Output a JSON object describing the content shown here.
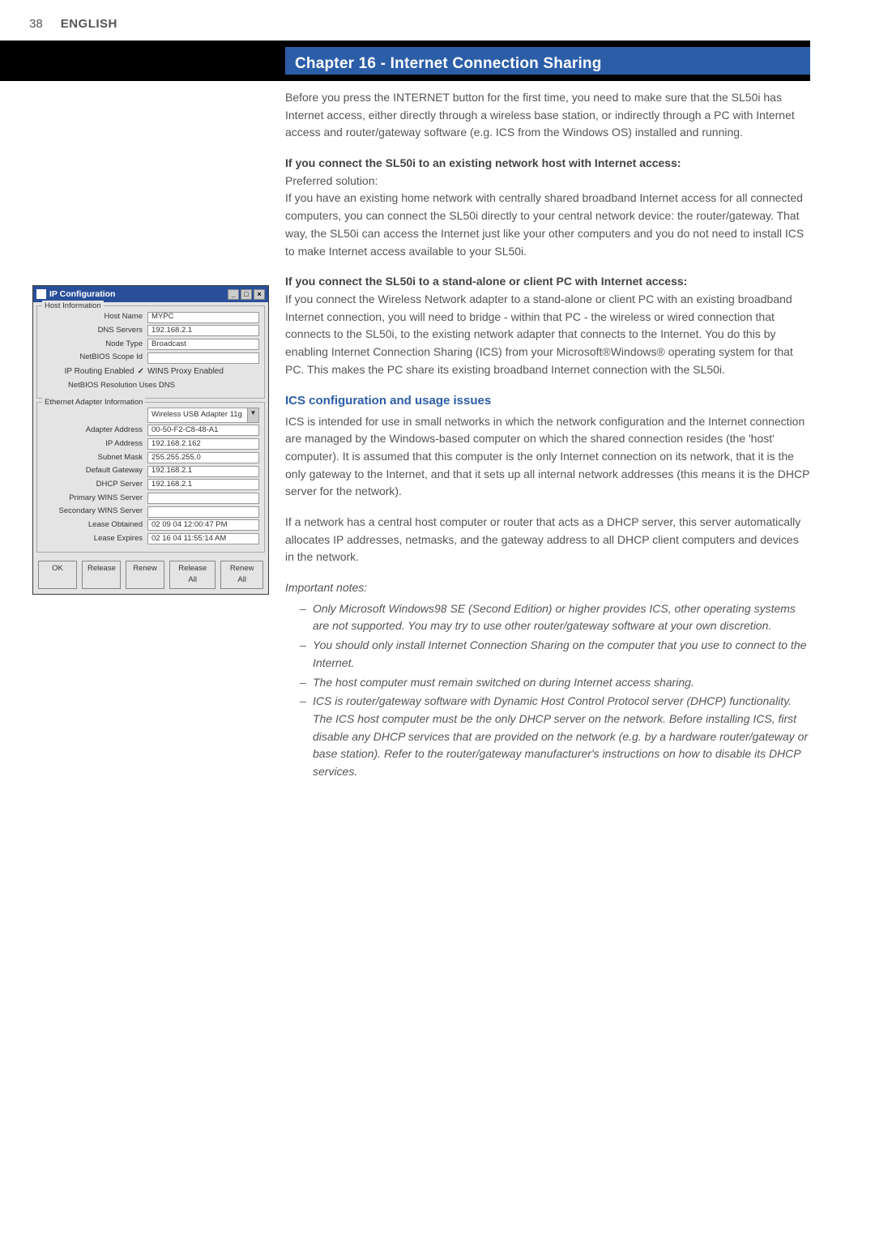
{
  "header": {
    "page_number": "38",
    "language": "ENGLISH"
  },
  "banner": {
    "title": "Chapter 16 - Internet Connection Sharing"
  },
  "body": {
    "intro": "Before you press the INTERNET button for the first time, you need to make sure that the SL50i has Internet access, either directly through a wireless base station, or indirectly through a PC with Internet access and router/gateway software (e.g. ICS from the Windows OS) installed and running.",
    "scen1_head": "If you connect the SL50i to an existing network host with Internet access:",
    "scen1_sub": "Preferred solution:",
    "scen1_body": "If you have an existing home network with centrally shared broadband Internet access for all connected computers, you can connect the SL50i directly to your central network device: the router/gateway. That way, the SL50i can access the Internet just like your other computers and you do not need to install ICS to make Internet access available to your SL50i.",
    "scen2_head": "If you connect the SL50i to a stand-alone or client PC with Internet access:",
    "scen2_body": "If you connect the Wireless Network adapter to a stand-alone or client PC with an existing broadband Internet connection, you will need to bridge - within that PC - the wireless or wired connection that connects to the SL50i, to the existing network adapter that connects to the Internet. You do this by enabling Internet Connection Sharing (ICS) from your Microsoft®Windows® operating system for that PC. This makes the PC share its existing broadband Internet connection with the SL50i.",
    "ics_head": "ICS configuration and usage issues",
    "ics_p1": "ICS is intended for use in small networks in which the network configuration and the Internet connection are managed by the Windows-based computer on which the shared connection resides (the 'host' computer). It is assumed that this computer is the only Internet connection on its network, that it is the only gateway to the Internet, and that it sets up all internal network addresses (this means it is the DHCP server for the network).",
    "ics_p2": "If a network has a central host computer or router that acts as a DHCP server, this server automatically allocates IP addresses, netmasks, and the gateway address to all DHCP client computers and devices in the network.",
    "notes_head": "Important notes:",
    "notes": [
      "Only Microsoft Windows98 SE (Second Edition) or higher provides ICS, other operating systems are not supported. You may try to use other router/gateway software at your own discretion.",
      "You should only install Internet Connection Sharing on the computer that you use to connect to the Internet.",
      "The host computer must remain switched on during Internet access sharing.",
      "ICS is router/gateway software with Dynamic Host Control Protocol server (DHCP) functionality. The ICS host computer must be the only DHCP server on the network. Before installing ICS, first disable any DHCP services that are provided on the network (e.g. by a hardware router/gateway or base station). Refer to the router/gateway manufacturer's instructions on how to disable its DHCP services."
    ]
  },
  "ipwin": {
    "title": "IP Configuration",
    "host_legend": "Host Information",
    "eth_legend": "Ethernet Adapter Information",
    "fields": {
      "host_name_l": "Host Name",
      "host_name_v": "MYPC",
      "dns_l": "DNS Servers",
      "dns_v": "192.168.2.1",
      "node_l": "Node Type",
      "node_v": "Broadcast",
      "scope_l": "NetBIOS Scope Id",
      "scope_v": "",
      "iproute_l": "IP Routing Enabled",
      "wins_proxy_l": "WINS Proxy Enabled",
      "nbres_l": "NetBIOS Resolution Uses DNS",
      "adapter_sel": "Wireless USB Adapter 11g",
      "aaddr_l": "Adapter Address",
      "aaddr_v": "00-50-F2-C8-48-A1",
      "ipaddr_l": "IP Address",
      "ipaddr_v": "192.168.2.162",
      "subnet_l": "Subnet Mask",
      "subnet_v": "255.255.255.0",
      "defgw_l": "Default Gateway",
      "defgw_v": "192.168.2.1",
      "dhcp_l": "DHCP Server",
      "dhcp_v": "192.168.2.1",
      "pwins_l": "Primary WINS Server",
      "pwins_v": "",
      "swins_l": "Secondary WINS Server",
      "swins_v": "",
      "lobt_l": "Lease Obtained",
      "lobt_v": "02 09 04 12:00:47 PM",
      "lexp_l": "Lease Expires",
      "lexp_v": "02 16 04 11:55:14 AM"
    },
    "buttons": {
      "ok": "OK",
      "release": "Release",
      "renew": "Renew",
      "release_all": "Release All",
      "renew_all": "Renew All"
    }
  }
}
